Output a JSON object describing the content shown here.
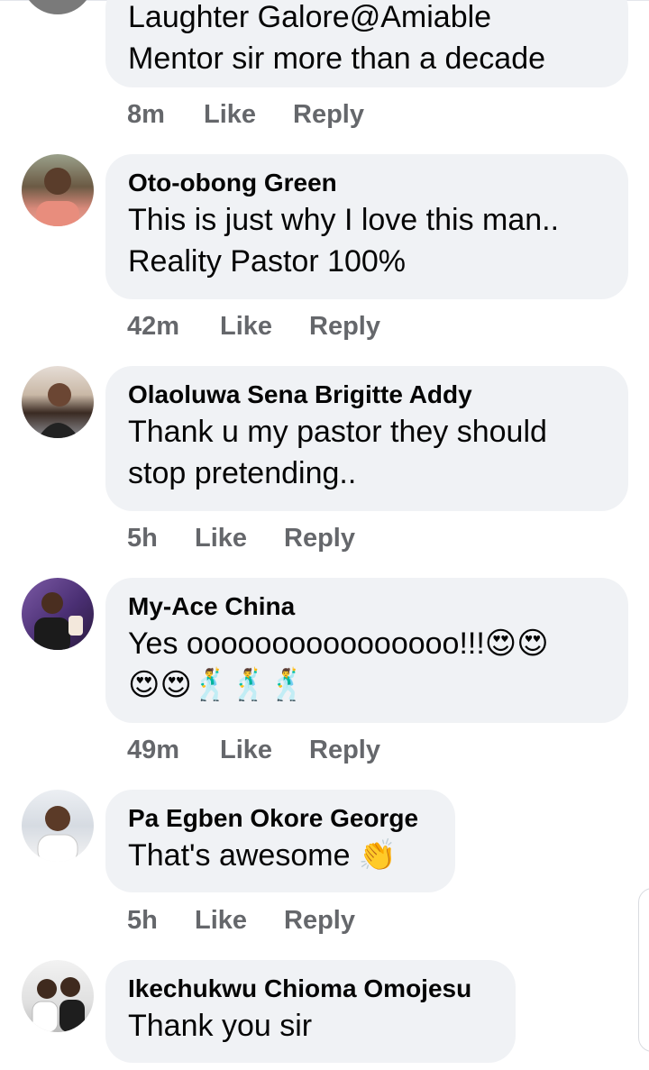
{
  "comments": [
    {
      "author": "",
      "lines": [
        "Laughter Galore@Amiable",
        "Mentor sir more than a decade"
      ],
      "time": "8m",
      "like": "Like",
      "reply": "Reply"
    },
    {
      "author": "Oto-obong Green",
      "lines": [
        "This is just why I love this man..",
        "Reality Pastor 100%"
      ],
      "time": "42m",
      "like": "Like",
      "reply": "Reply"
    },
    {
      "author": "Olaoluwa Sena Brigitte Addy",
      "lines": [
        "Thank u my pastor they should",
        "stop pretending.."
      ],
      "time": "5h",
      "like": "Like",
      "reply": "Reply"
    },
    {
      "author": "My-Ace China",
      "lines": [
        "Yes oooooooooooooooo!!!😍😍",
        "😍😍🕺🕺🕺"
      ],
      "time": "49m",
      "like": "Like",
      "reply": "Reply"
    },
    {
      "author": "Pa Egben Okore George",
      "lines": [
        "That's awesome 👏"
      ],
      "time": "5h",
      "like": "Like",
      "reply": "Reply"
    },
    {
      "author": "Ikechukwu Chioma Omojesu",
      "lines": [
        "Thank you sir"
      ],
      "time": "",
      "like": "",
      "reply": ""
    }
  ]
}
